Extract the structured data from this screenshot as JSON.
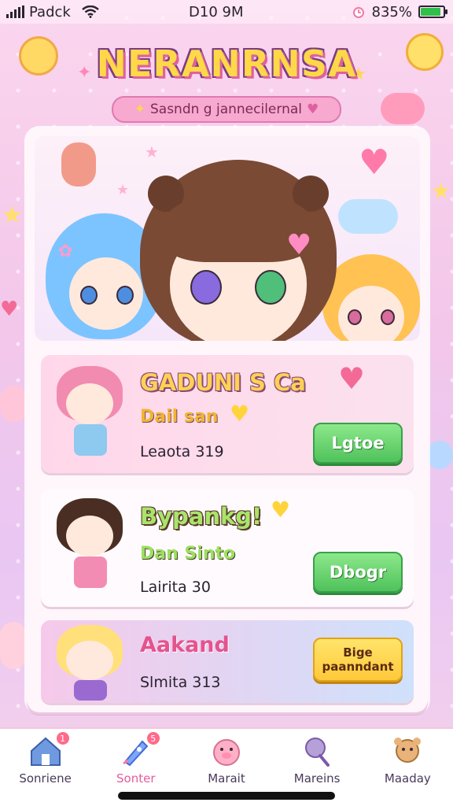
{
  "status_bar": {
    "carrier": "Padck",
    "time": "D10 9M",
    "battery": "835%"
  },
  "header": {
    "title": "NERANRNSA",
    "subtitle": "Sasndn g jannecilernal"
  },
  "games": [
    {
      "title": "GADUNI S Ca",
      "subtitle": "Dail san",
      "meta": "Leaota 319",
      "button": "Lgtoe"
    },
    {
      "title": "Bypankg!",
      "subtitle": "Dan Sinto",
      "meta": "Lairita 30",
      "button": "Dbogr"
    },
    {
      "title": "Aakand",
      "subtitle": "",
      "meta": "Slmita 313",
      "button_line1": "Bige",
      "button_line2": "paanndant"
    }
  ],
  "nav": [
    {
      "label": "Sonriene",
      "icon": "home-icon",
      "badge": "1"
    },
    {
      "label": "Sonter",
      "icon": "rocket-icon",
      "badge": "5"
    },
    {
      "label": "Marait",
      "icon": "pig-icon",
      "badge": ""
    },
    {
      "label": "Mareins",
      "icon": "character-icon",
      "badge": ""
    },
    {
      "label": "Maaday",
      "icon": "bear-icon",
      "badge": ""
    }
  ],
  "colors": {
    "accent_pink": "#e65c9c",
    "play_green": "#4fc25b",
    "gold": "#ffc93a",
    "battery_green": "#2fbf4a"
  }
}
